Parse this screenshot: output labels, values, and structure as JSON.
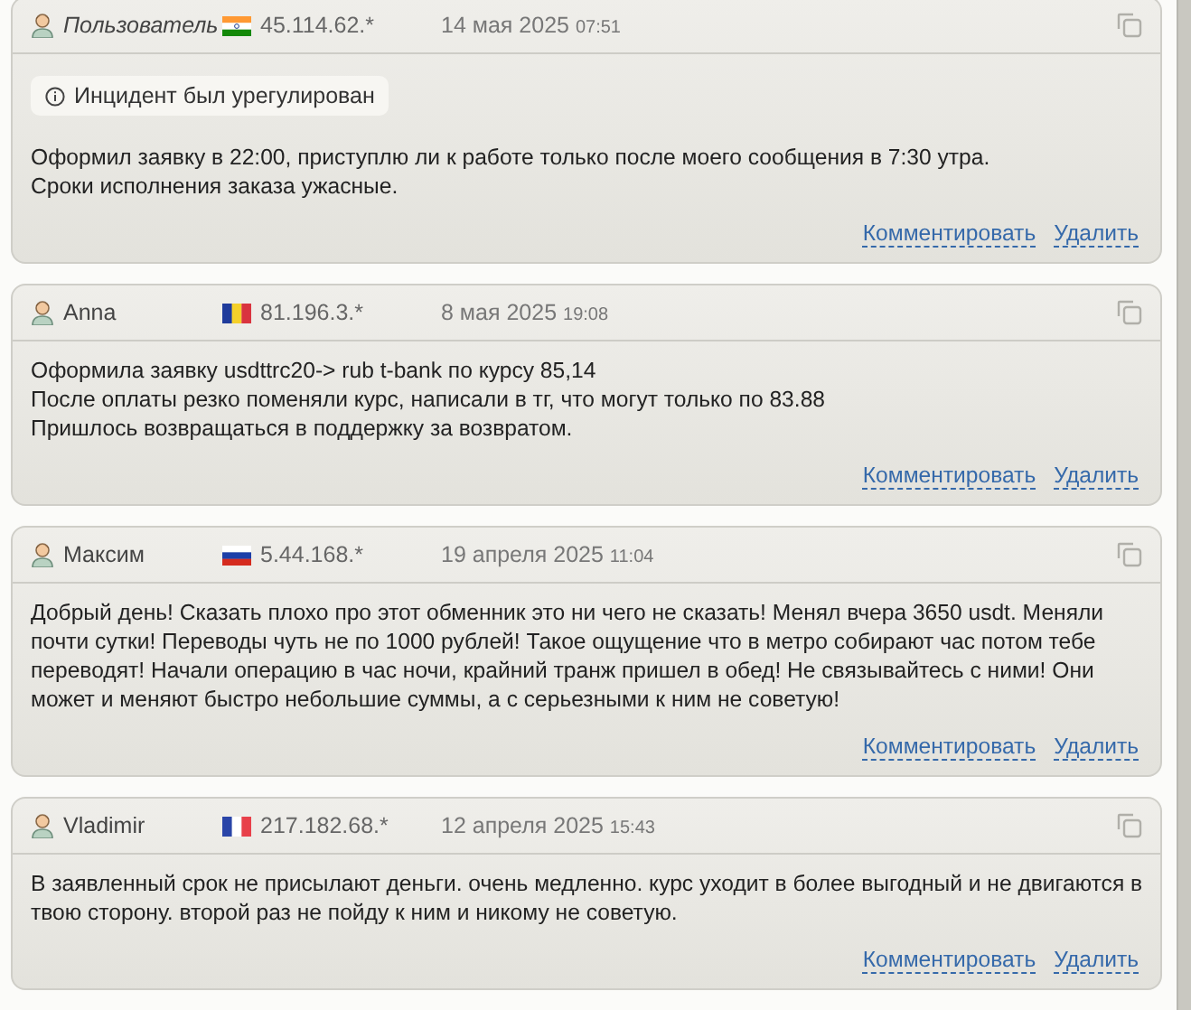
{
  "reviews": [
    {
      "author": "Пользователь",
      "anonymous": true,
      "flag": {
        "kind": "india"
      },
      "ip": "45.114.62.*",
      "date": "14 мая 2025",
      "time": "07:51",
      "notice": "Инцидент был урегулирован",
      "lines": [
        "Оформил заявку в 22:00, приступлю ли к работе только после моего сообщения в 7:30 утра.",
        "Сроки исполнения заказа ужасные."
      ],
      "actions": [
        "Комментировать",
        "Удалить"
      ]
    },
    {
      "author": "Anna",
      "anonymous": false,
      "flag": {
        "kind": "romania"
      },
      "ip": "81.196.3.*",
      "date": "8 мая 2025",
      "time": "19:08",
      "lines": [
        "Оформила заявку usdttrc20-> rub t-bank по курсу 85,14",
        "После оплаты резко поменяли курс, написали в тг, что могут только по 83.88",
        "Пришлось возвращаться в поддержку за возвратом."
      ],
      "actions": [
        "Комментировать",
        "Удалить"
      ]
    },
    {
      "author": "Максим",
      "anonymous": false,
      "flag": {
        "kind": "russia"
      },
      "ip": "5.44.168.*",
      "date": "19 апреля 2025",
      "time": "11:04",
      "lines": [
        "Добрый день! Сказать плохо про этот обменник это ни чего не сказать! Менял вчера 3650 usdt. Меняли",
        "почти сутки! Переводы чуть не по 1000 рублей! Такое ощущение что в метро собирают час потом тебе",
        "переводят! Начали операцию в час ночи, крайний транж пришел в обед! Не связывайтесь с ними! Они",
        "может и меняют быстро небольшие суммы, а с серьезными к ним не советую!"
      ],
      "actions": [
        "Комментировать",
        "Удалить"
      ]
    },
    {
      "author": "Vladimir",
      "anonymous": false,
      "flag": {
        "kind": "france"
      },
      "ip": "217.182.68.*",
      "date": "12 апреля 2025",
      "time": "15:43",
      "lines": [
        "В заявленный срок не присылают деньги. очень медленно. курс уходит в более выгодный и не двигаются в",
        "твою сторону. второй раз не пойду к ним и никому не советую."
      ],
      "actions": [
        "Комментировать",
        "Удалить"
      ]
    }
  ]
}
